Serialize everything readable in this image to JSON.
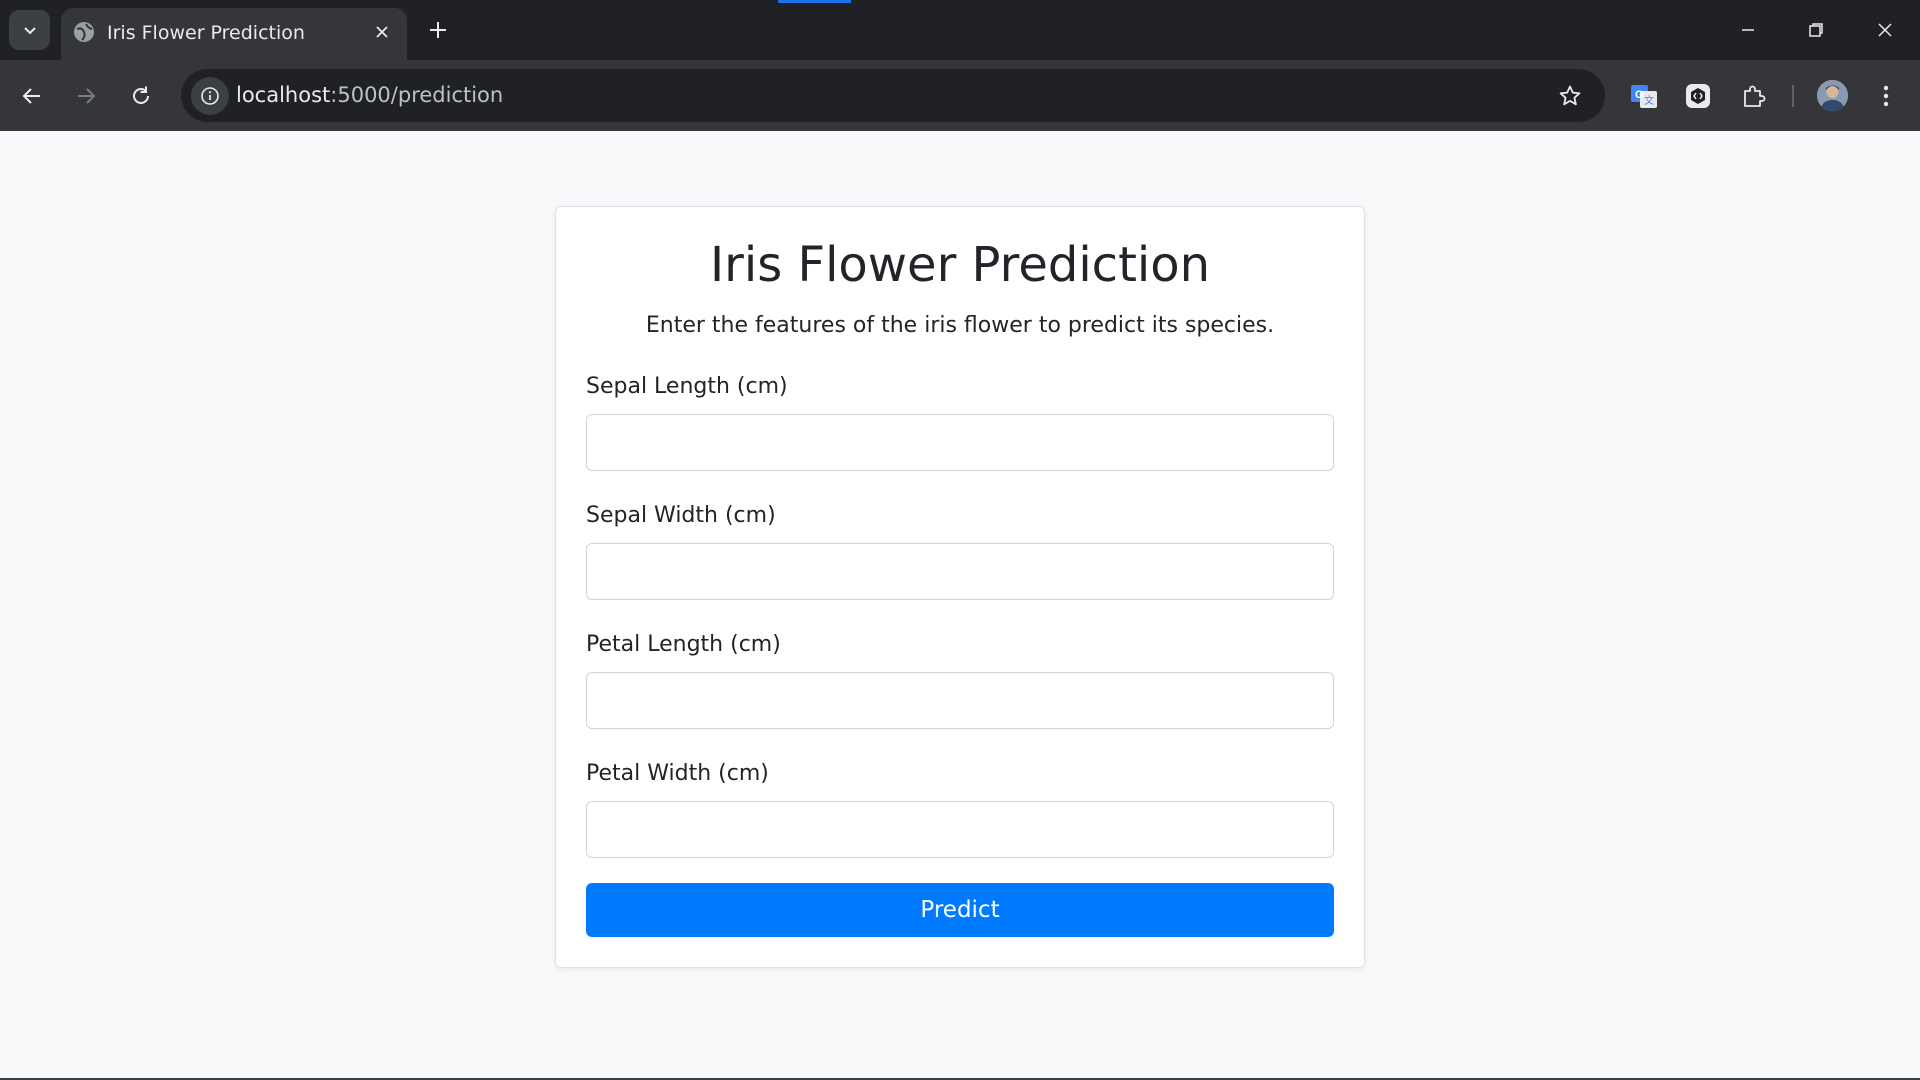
{
  "browser": {
    "tab_title": "Iris Flower Prediction",
    "url_host": "localhost",
    "url_path": ":5000/prediction"
  },
  "form": {
    "title": "Iris Flower Prediction",
    "subtitle": "Enter the features of the iris flower to predict its species.",
    "fields": [
      {
        "label": "Sepal Length (cm)",
        "value": ""
      },
      {
        "label": "Sepal Width (cm)",
        "value": ""
      },
      {
        "label": "Petal Length (cm)",
        "value": ""
      },
      {
        "label": "Petal Width (cm)",
        "value": ""
      }
    ],
    "submit_label": "Predict"
  },
  "colors": {
    "primary_button": "#007bff",
    "page_background": "#f8f9fa",
    "chrome_dark": "#202124"
  }
}
